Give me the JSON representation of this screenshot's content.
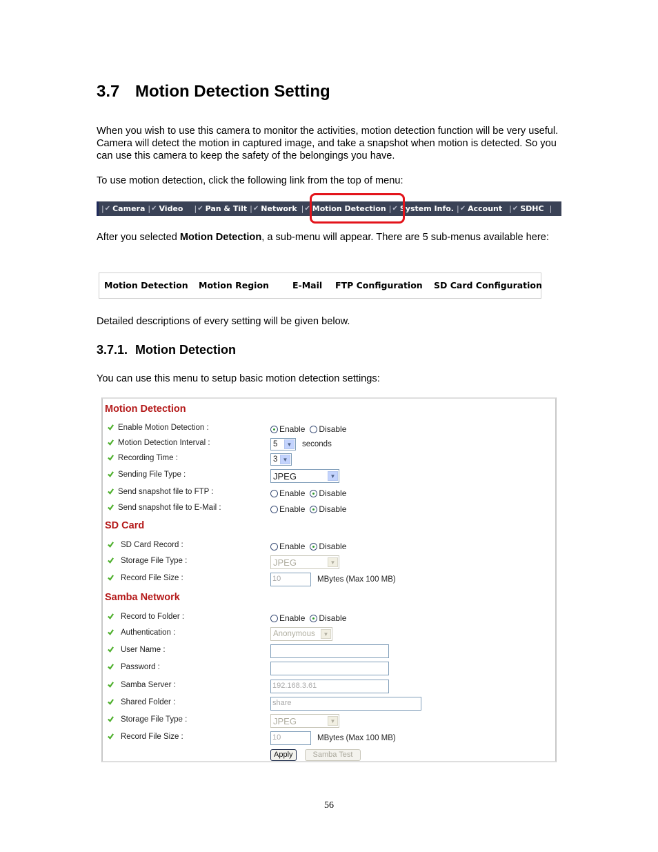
{
  "section": {
    "number": "3.7",
    "title": "Motion Detection Setting"
  },
  "paragraphs": {
    "intro": "When you wish to use this camera to monitor the activities, motion detection function will be very useful. Camera will detect the motion in captured image, and take a snapshot when motion is detected. So you can use this camera to keep the safety of the belongings you have.",
    "instruction": "To use motion detection, click the following link from the top of menu:",
    "after_prefix": "After you selected ",
    "after_bold": "Motion Detection",
    "after_suffix": ", a sub-menu will appear. There are 5 sub-menus available here:",
    "details": "Detailed descriptions of every setting will be given below.",
    "menu_use": "You can use this menu to setup basic motion detection settings:"
  },
  "top_menu": {
    "items": [
      "Camera",
      "Video",
      "Pan & Tilt",
      "Network",
      "Motion Detection",
      "System Info.",
      "Account",
      "SDHC"
    ],
    "highlighted": "Motion Detection",
    "icon": "check-icon",
    "bar_color": "#3a4256",
    "highlight_color": "#e3141b"
  },
  "sub_menu": {
    "items": [
      "Motion Detection",
      "Motion Region",
      "E-Mail",
      "FTP Configuration",
      "SD Card Configuration"
    ]
  },
  "subsection": {
    "number": "3.7.1.",
    "title": "Motion Detection"
  },
  "panel": {
    "accent_color": "#b41919",
    "motion_detection": {
      "title": "Motion Detection",
      "enable_label": "Enable Motion Detection :",
      "enable_value": "Enable",
      "interval_label": "Motion Detection Interval :",
      "interval_value": "5",
      "interval_unit": "seconds",
      "recording_label": "Recording Time :",
      "recording_value": "3",
      "file_type_label": "Sending File Type :",
      "file_type_value": "JPEG",
      "ftp_label": "Send snapshot file to FTP :",
      "ftp_value": "Disable",
      "email_label": "Send snapshot file to E-Mail :",
      "email_value": "Disable"
    },
    "sd_card": {
      "title": "SD Card",
      "record_label": "SD Card Record :",
      "record_value": "Disable",
      "storage_type_label": "Storage File Type :",
      "storage_type_value": "JPEG",
      "file_size_label": "Record File Size :",
      "file_size_value": "10",
      "file_size_unit": "MBytes (Max 100 MB)"
    },
    "samba": {
      "title": "Samba Network",
      "record_label": "Record to Folder :",
      "record_value": "Disable",
      "auth_label": "Authentication :",
      "auth_value": "Anonymous",
      "user_label": "User Name :",
      "user_value": "",
      "password_label": "Password :",
      "password_value": "",
      "server_label": "Samba Server :",
      "server_value": "192.168.3.61",
      "folder_label": "Shared Folder :",
      "folder_value": "share",
      "storage_type_label": "Storage File Type :",
      "storage_type_value": "JPEG",
      "file_size_label": "Record File Size :",
      "file_size_value": "10",
      "file_size_unit": "MBytes (Max 100 MB)"
    },
    "radio_labels": {
      "enable": "Enable",
      "disable": "Disable"
    },
    "buttons": {
      "apply": "Apply",
      "samba_test": "Samba Test"
    }
  },
  "page_number": "56"
}
